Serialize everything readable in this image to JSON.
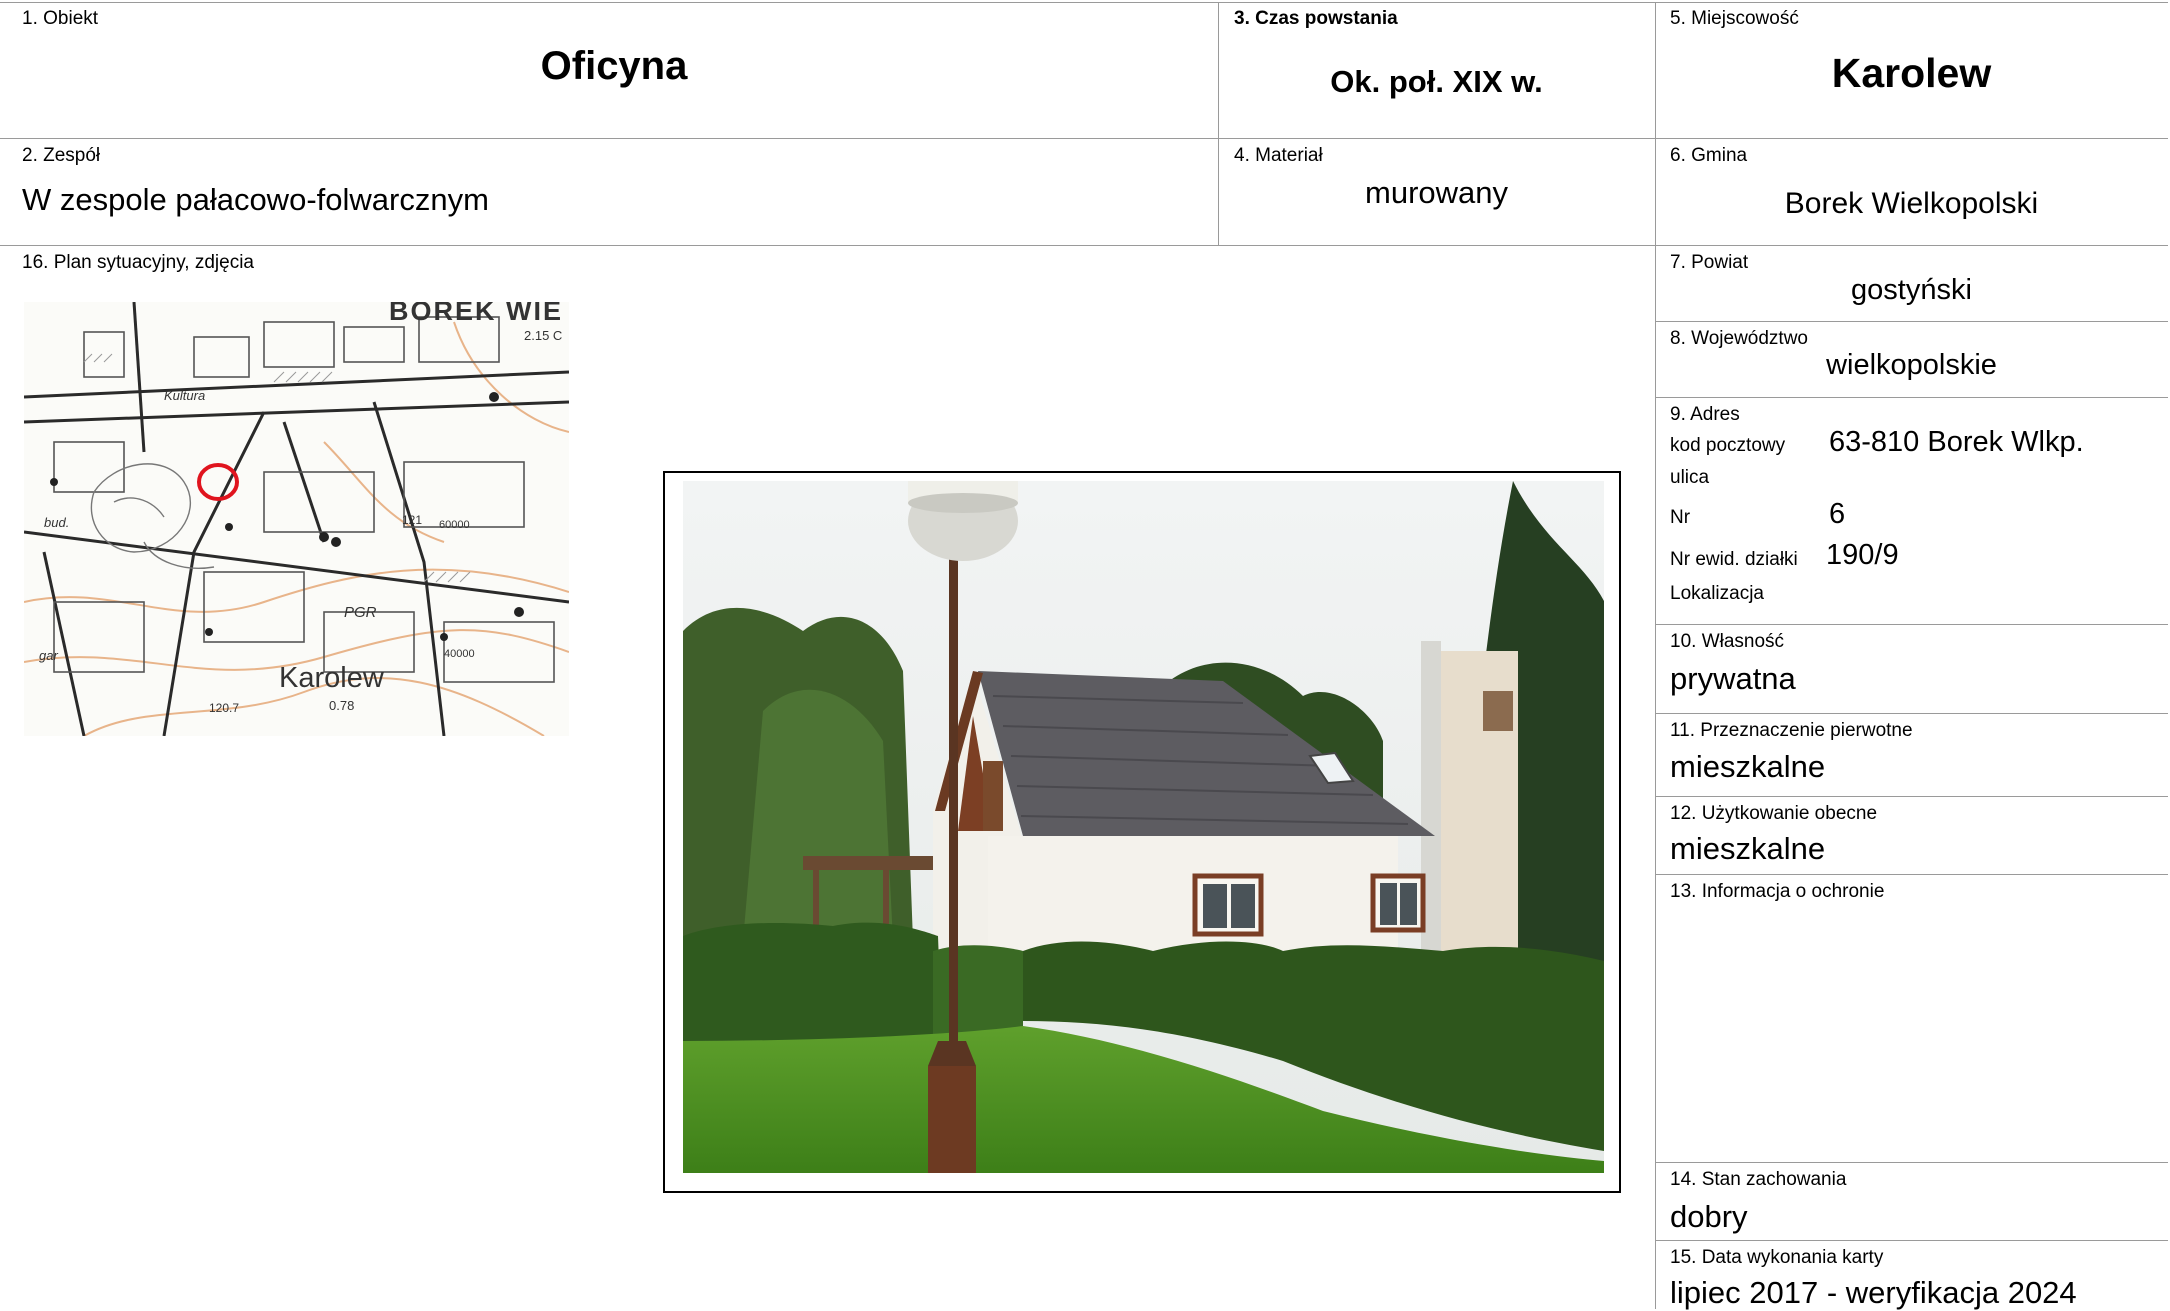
{
  "fields": {
    "obiekt": {
      "label": "1. Obiekt",
      "value": "Oficyna"
    },
    "zespol": {
      "label": "2. Zespół",
      "value": "W zespole pałacowo-folwarcznym"
    },
    "czas": {
      "label": "3. Czas powstania",
      "value": "Ok. poł. XIX w."
    },
    "material": {
      "label": "4. Materiał",
      "value": "murowany"
    },
    "miejscowosc": {
      "label": "5. Miejscowość",
      "value": "Karolew"
    },
    "gmina": {
      "label": "6. Gmina",
      "value": "Borek Wielkopolski"
    },
    "powiat": {
      "label": "7. Powiat",
      "value": "gostyński"
    },
    "wojewodztwo": {
      "label": "8. Województwo",
      "value": "wielkopolskie"
    },
    "adres": {
      "label": "9. Adres",
      "kod_label": "kod pocztowy",
      "kod_value": "63-810 Borek Wlkp.",
      "ulica_label": "ulica",
      "nr_label": "Nr",
      "nr_value": "6",
      "dzialka_label": "Nr ewid. działki",
      "dzialka_value": "190/9",
      "lokalizacja_label": "Lokalizacja"
    },
    "wlasnosc": {
      "label": "10. Własność",
      "value": "prywatna"
    },
    "przeznaczenie": {
      "label": "11. Przeznaczenie pierwotne",
      "value": "mieszkalne"
    },
    "uzytkowanie": {
      "label": "12. Użytkowanie obecne",
      "value": "mieszkalne"
    },
    "ochrona": {
      "label": "13. Informacja o ochronie"
    },
    "stan": {
      "label": "14. Stan zachowania",
      "value": "dobry"
    },
    "data": {
      "label": "15. Data wykonania karty",
      "value": "lipiec 2017 - weryfikacja 2024"
    },
    "plan": {
      "label": "16. Plan sytuacyjny, zdjęcia"
    }
  },
  "map": {
    "town_label": "BOREK WIE",
    "village_label": "Karolew",
    "labels": [
      "Kultura",
      "bud.",
      "PGR",
      "gar",
      "2.15 C",
      "121",
      "120.7",
      "0.78",
      "60000",
      "40000"
    ],
    "marker_color": "#e0141e"
  }
}
